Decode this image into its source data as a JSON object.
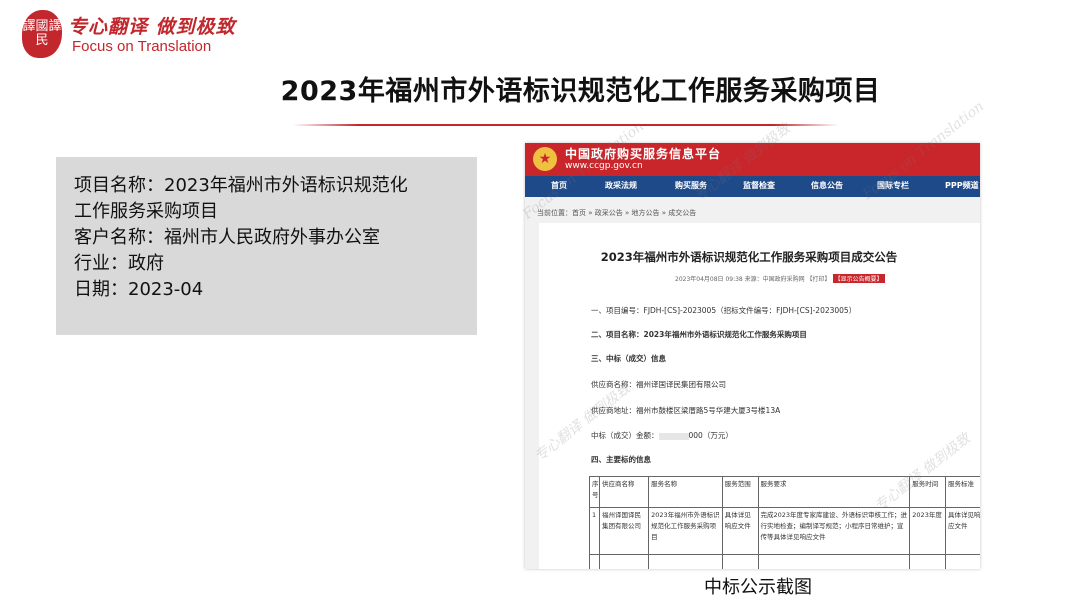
{
  "logo": {
    "seal_text": "譯國譯民",
    "slogan": "专心翻译 做到极致",
    "tagline": "Focus on Translation"
  },
  "title": "2023年福州市外语标识规范化工作服务采购项目",
  "info": {
    "line1": "项目名称：2023年福州市外语标识规范化",
    "line2": "工作服务采购项目",
    "line3": "客户名称：福州市人民政府外事办公室",
    "line4": "行业：政府",
    "line5": "日期：2023-04"
  },
  "screenshot": {
    "site_name": "中国政府购买服务信息平台",
    "site_url": "www.ccgp.gov.cn",
    "nav": [
      "首页",
      "政采法规",
      "购买服务",
      "监督检查",
      "信息公告",
      "国际专栏",
      "PPP频道"
    ],
    "breadcrumb": "当前位置：首页 » 政采公告 » 地方公告 » 成交公告",
    "notice_title": "2023年福州市外语标识规范化工作服务采购项目成交公告",
    "meta": "2023年04月08日 09:38 来源：中国政府采购网 【打印】",
    "meta_button": "【显示公告概要】",
    "line_project_no": "一、项目编号：FJDH-[CS]-2023005（招标文件编号：FJDH-[CS]-2023005）",
    "line_project_name": "二、项目名称：2023年福州市外语标识规范化工作服务采购项目",
    "line_result_head": "三、中标（成交）信息",
    "line_supplier": "供应商名称：福州译国译民集团有限公司",
    "line_address": "供应商地址：福州市鼓楼区梁厝路5号华建大厦3号楼13A",
    "line_amount_prefix": "中标（成交）金额：",
    "line_amount_suffix": "000（万元）",
    "line_subject": "四、主要标的信息",
    "table_headers": [
      "序号",
      "供应商名称",
      "服务名称",
      "服务范围",
      "服务要求",
      "服务时间",
      "服务标准"
    ],
    "table_row": [
      "1",
      "福州译国译民集团有限公司",
      "2023年福州市外语标识规范化工作服务采购项目",
      "具体详见响应文件",
      "完成2023年度专家库建设、外语标识审核工作；进行实地检查；编制译写规范；小程序日常维护；宣传等具体详见响应文件",
      "2023年度",
      "具体详见响应文件"
    ]
  },
  "caption": "中标公示截图",
  "colors": {
    "brand_red": "#c2272d",
    "nav_blue": "#1f4a8a",
    "info_bg": "#d9d9d9"
  }
}
